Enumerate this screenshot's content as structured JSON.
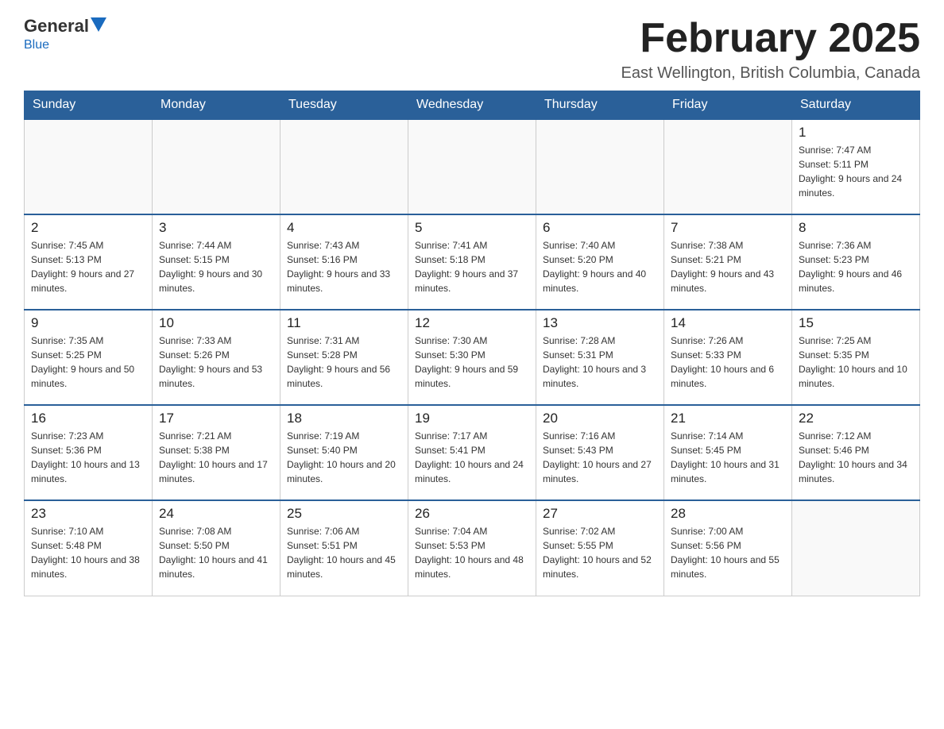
{
  "header": {
    "logo_general": "General",
    "logo_blue": "Blue",
    "month_title": "February 2025",
    "location": "East Wellington, British Columbia, Canada"
  },
  "days_of_week": [
    "Sunday",
    "Monday",
    "Tuesday",
    "Wednesday",
    "Thursday",
    "Friday",
    "Saturday"
  ],
  "weeks": [
    [
      {
        "day": "",
        "info": ""
      },
      {
        "day": "",
        "info": ""
      },
      {
        "day": "",
        "info": ""
      },
      {
        "day": "",
        "info": ""
      },
      {
        "day": "",
        "info": ""
      },
      {
        "day": "",
        "info": ""
      },
      {
        "day": "1",
        "info": "Sunrise: 7:47 AM\nSunset: 5:11 PM\nDaylight: 9 hours and 24 minutes."
      }
    ],
    [
      {
        "day": "2",
        "info": "Sunrise: 7:45 AM\nSunset: 5:13 PM\nDaylight: 9 hours and 27 minutes."
      },
      {
        "day": "3",
        "info": "Sunrise: 7:44 AM\nSunset: 5:15 PM\nDaylight: 9 hours and 30 minutes."
      },
      {
        "day": "4",
        "info": "Sunrise: 7:43 AM\nSunset: 5:16 PM\nDaylight: 9 hours and 33 minutes."
      },
      {
        "day": "5",
        "info": "Sunrise: 7:41 AM\nSunset: 5:18 PM\nDaylight: 9 hours and 37 minutes."
      },
      {
        "day": "6",
        "info": "Sunrise: 7:40 AM\nSunset: 5:20 PM\nDaylight: 9 hours and 40 minutes."
      },
      {
        "day": "7",
        "info": "Sunrise: 7:38 AM\nSunset: 5:21 PM\nDaylight: 9 hours and 43 minutes."
      },
      {
        "day": "8",
        "info": "Sunrise: 7:36 AM\nSunset: 5:23 PM\nDaylight: 9 hours and 46 minutes."
      }
    ],
    [
      {
        "day": "9",
        "info": "Sunrise: 7:35 AM\nSunset: 5:25 PM\nDaylight: 9 hours and 50 minutes."
      },
      {
        "day": "10",
        "info": "Sunrise: 7:33 AM\nSunset: 5:26 PM\nDaylight: 9 hours and 53 minutes."
      },
      {
        "day": "11",
        "info": "Sunrise: 7:31 AM\nSunset: 5:28 PM\nDaylight: 9 hours and 56 minutes."
      },
      {
        "day": "12",
        "info": "Sunrise: 7:30 AM\nSunset: 5:30 PM\nDaylight: 9 hours and 59 minutes."
      },
      {
        "day": "13",
        "info": "Sunrise: 7:28 AM\nSunset: 5:31 PM\nDaylight: 10 hours and 3 minutes."
      },
      {
        "day": "14",
        "info": "Sunrise: 7:26 AM\nSunset: 5:33 PM\nDaylight: 10 hours and 6 minutes."
      },
      {
        "day": "15",
        "info": "Sunrise: 7:25 AM\nSunset: 5:35 PM\nDaylight: 10 hours and 10 minutes."
      }
    ],
    [
      {
        "day": "16",
        "info": "Sunrise: 7:23 AM\nSunset: 5:36 PM\nDaylight: 10 hours and 13 minutes."
      },
      {
        "day": "17",
        "info": "Sunrise: 7:21 AM\nSunset: 5:38 PM\nDaylight: 10 hours and 17 minutes."
      },
      {
        "day": "18",
        "info": "Sunrise: 7:19 AM\nSunset: 5:40 PM\nDaylight: 10 hours and 20 minutes."
      },
      {
        "day": "19",
        "info": "Sunrise: 7:17 AM\nSunset: 5:41 PM\nDaylight: 10 hours and 24 minutes."
      },
      {
        "day": "20",
        "info": "Sunrise: 7:16 AM\nSunset: 5:43 PM\nDaylight: 10 hours and 27 minutes."
      },
      {
        "day": "21",
        "info": "Sunrise: 7:14 AM\nSunset: 5:45 PM\nDaylight: 10 hours and 31 minutes."
      },
      {
        "day": "22",
        "info": "Sunrise: 7:12 AM\nSunset: 5:46 PM\nDaylight: 10 hours and 34 minutes."
      }
    ],
    [
      {
        "day": "23",
        "info": "Sunrise: 7:10 AM\nSunset: 5:48 PM\nDaylight: 10 hours and 38 minutes."
      },
      {
        "day": "24",
        "info": "Sunrise: 7:08 AM\nSunset: 5:50 PM\nDaylight: 10 hours and 41 minutes."
      },
      {
        "day": "25",
        "info": "Sunrise: 7:06 AM\nSunset: 5:51 PM\nDaylight: 10 hours and 45 minutes."
      },
      {
        "day": "26",
        "info": "Sunrise: 7:04 AM\nSunset: 5:53 PM\nDaylight: 10 hours and 48 minutes."
      },
      {
        "day": "27",
        "info": "Sunrise: 7:02 AM\nSunset: 5:55 PM\nDaylight: 10 hours and 52 minutes."
      },
      {
        "day": "28",
        "info": "Sunrise: 7:00 AM\nSunset: 5:56 PM\nDaylight: 10 hours and 55 minutes."
      },
      {
        "day": "",
        "info": ""
      }
    ]
  ]
}
